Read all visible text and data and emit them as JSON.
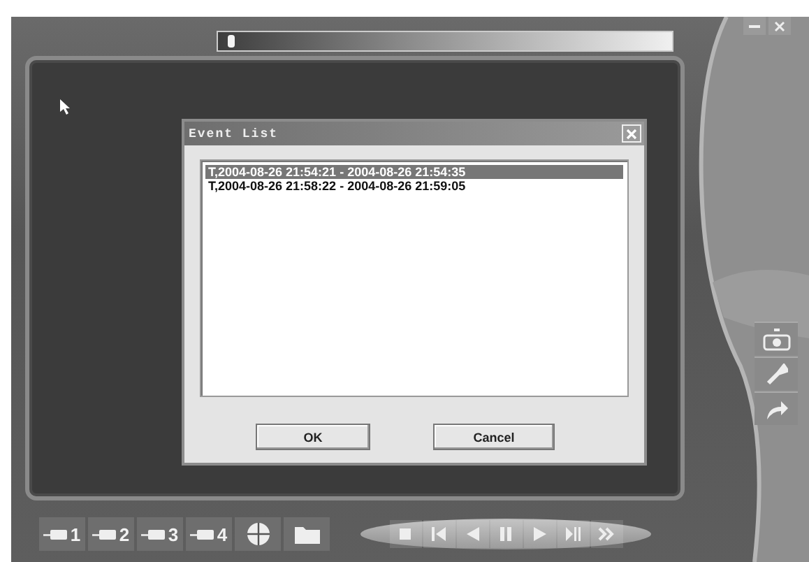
{
  "progress": {
    "level": 0.02
  },
  "dialog": {
    "title": "Event List",
    "events": [
      {
        "text": "T,2004-08-26 21:54:21 - 2004-08-26 21:54:35",
        "selected": true
      },
      {
        "text": "T,2004-08-26 21:58:22 - 2004-08-26 21:59:05",
        "selected": false
      }
    ],
    "buttons": [
      "OK",
      "Cancel"
    ]
  },
  "camera_buttons": [
    "1",
    "2",
    "3",
    "4"
  ]
}
